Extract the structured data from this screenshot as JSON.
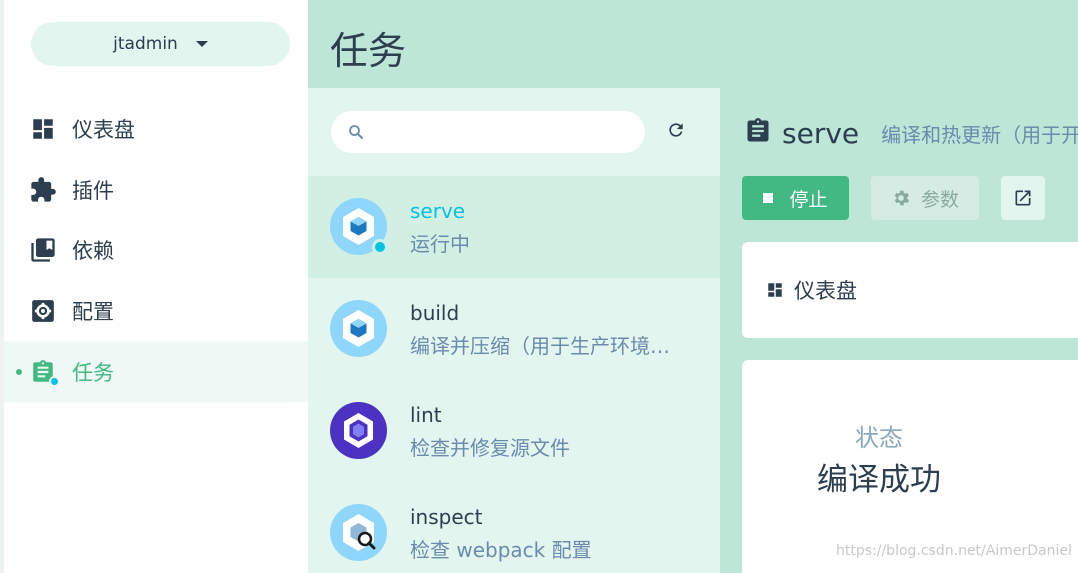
{
  "sidebar": {
    "project": "jtadmin",
    "items": [
      {
        "label": "仪表盘",
        "icon": "dashboard-icon"
      },
      {
        "label": "插件",
        "icon": "puzzle-icon"
      },
      {
        "label": "依赖",
        "icon": "library-books-icon"
      },
      {
        "label": "配置",
        "icon": "settings-box-icon"
      },
      {
        "label": "任务",
        "icon": "clipboard-icon",
        "active": true
      }
    ]
  },
  "header": {
    "title": "任务"
  },
  "tasks": [
    {
      "name": "serve",
      "desc": "运行中",
      "icon": "webpack-icon",
      "status": "running"
    },
    {
      "name": "build",
      "desc": "编译并压缩（用于生产环境…",
      "icon": "webpack-icon"
    },
    {
      "name": "lint",
      "desc": "检查并修复源文件",
      "icon": "eslint-icon"
    },
    {
      "name": "inspect",
      "desc": "检查 webpack 配置",
      "icon": "webpack-inspect-icon"
    }
  ],
  "details": {
    "name": "serve",
    "desc": "编译和热更新（用于开",
    "stop_label": "停止",
    "params_label": "参数",
    "dashboard_label": "仪表盘",
    "status_label": "状态",
    "status_value": "编译成功"
  },
  "watermark": "https://blog.csdn.net/AimerDaniel",
  "colors": {
    "accent": "#42b983",
    "header_bg": "#bde6d7",
    "list_bg": "#e2f5ee",
    "running": "#03c2e6"
  }
}
